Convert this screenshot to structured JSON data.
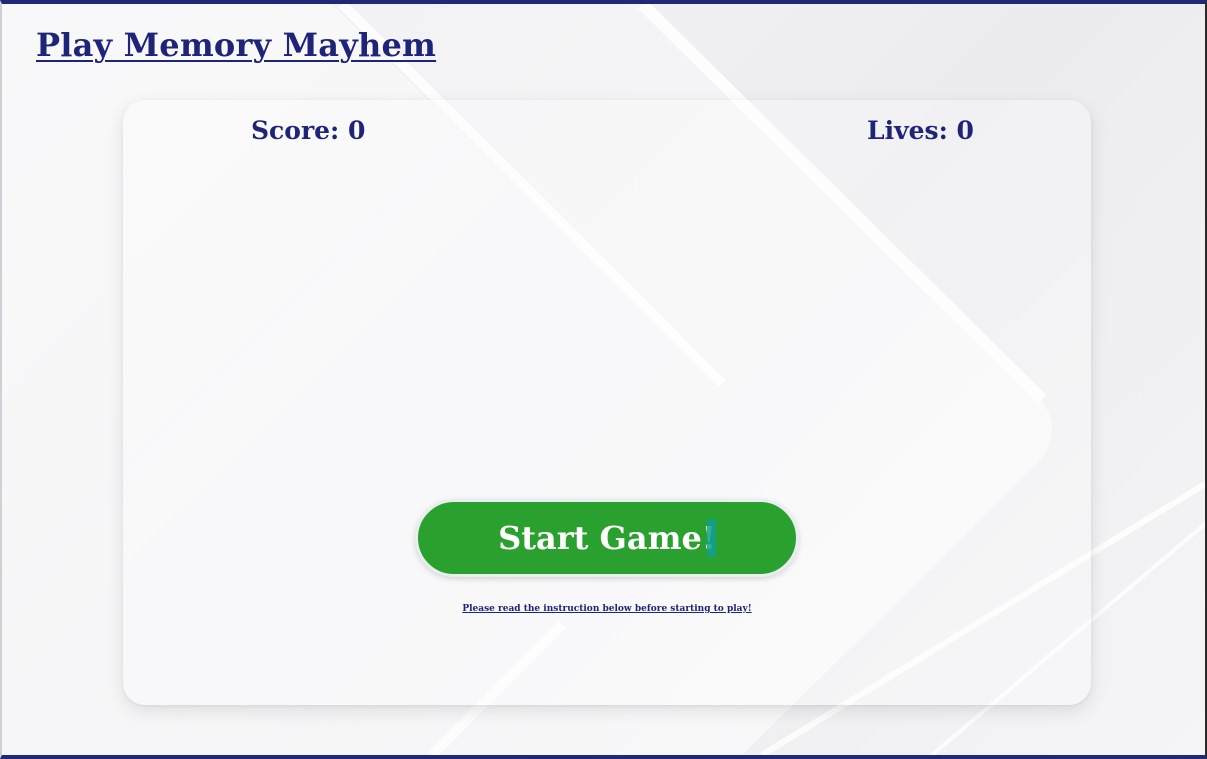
{
  "page": {
    "title": "Play Memory Mayhem"
  },
  "game": {
    "score_label": "Score: 0",
    "lives_label": "Lives: 0",
    "start_label": "Start Game!",
    "instruction_text": "Please read the instruction below before starting to play!"
  },
  "colors": {
    "title": "#1e2478",
    "button": "#2aa12e",
    "border_accent": "#1e2a78"
  }
}
